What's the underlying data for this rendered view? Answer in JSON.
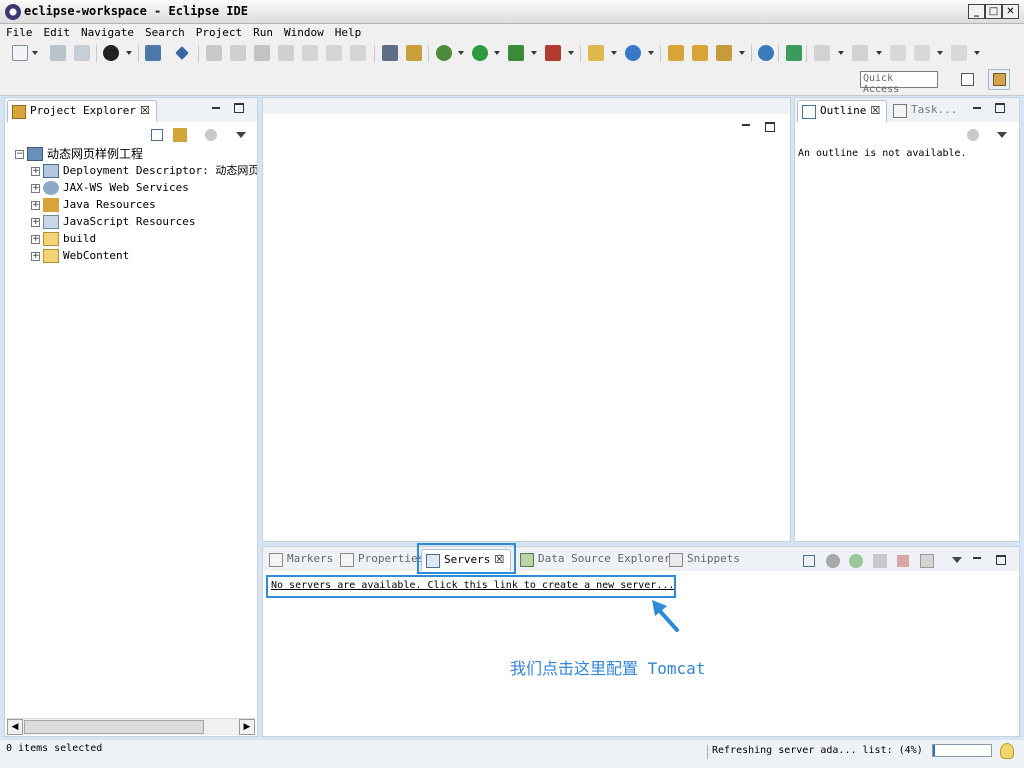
{
  "window": {
    "title": "eclipse-workspace - Eclipse IDE"
  },
  "menu": [
    "File",
    "Edit",
    "Navigate",
    "Search",
    "Project",
    "Run",
    "Window",
    "Help"
  ],
  "toolbar": {
    "quick_access_placeholder": "Quick Access"
  },
  "project_explorer": {
    "tab_label": "Project Explorer",
    "project_name": "动态网页样例工程",
    "items": [
      {
        "label": "Deployment Descriptor: 动态网页样"
      },
      {
        "label": "JAX-WS Web Services"
      },
      {
        "label": "Java Resources"
      },
      {
        "label": "JavaScript Resources"
      },
      {
        "label": "build"
      },
      {
        "label": "WebContent"
      }
    ]
  },
  "outline": {
    "tab_label": "Outline",
    "task_tab_label": "Task...",
    "message": "An outline is not available."
  },
  "bottom_panel": {
    "tabs": [
      {
        "label": "Markers"
      },
      {
        "label": "Properties"
      },
      {
        "label": "Servers"
      },
      {
        "label": "Data Source Explorer"
      },
      {
        "label": "Snippets"
      }
    ],
    "servers_link": "No servers are available. Click this link to create a new server..."
  },
  "annotation": {
    "text": "我们点击这里配置 Tomcat"
  },
  "statusbar": {
    "left_text": "0 items selected",
    "progress_text": "Refreshing server ada... list: (4%)"
  },
  "colors": {
    "highlight": "#2e8bd8",
    "background": "#d6e4f3"
  }
}
